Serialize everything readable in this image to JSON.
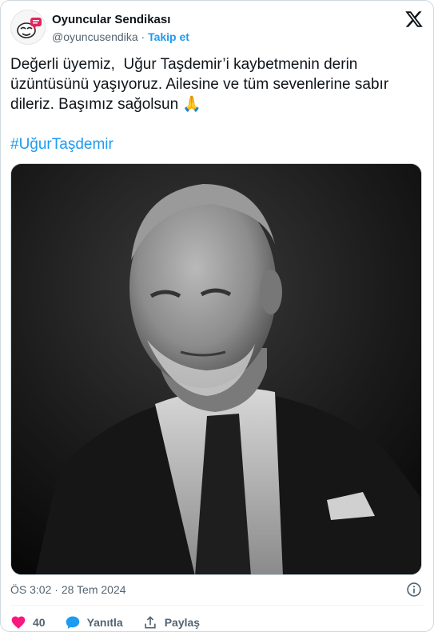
{
  "header": {
    "display_name": "Oyuncular Sendikası",
    "handle": "@oyuncusendika",
    "separator": "·",
    "follow_label": "Takip et"
  },
  "tweet": {
    "text": "Değerli üyemiz,  Uğur Taşdemir’i kaybetmenin derin üzüntüsünü yaşıyoruz. Ailesine ve tüm sevenlerine sabır dileriz. Başımız sağolsun 🙏",
    "hashtag": "#UğurTaşdemir"
  },
  "meta": {
    "time": "ÖS 3:02",
    "separator": "·",
    "date": "28 Tem 2024"
  },
  "actions": {
    "like_count": "40",
    "reply_label": "Yanıtla",
    "share_label": "Paylaş"
  },
  "colors": {
    "accent": "#1d9bf0",
    "like": "#f91880",
    "muted": "#536471"
  },
  "icons": {
    "brand": "x-logo-icon",
    "like": "heart-icon",
    "reply": "speech-bubble-icon",
    "share": "share-upload-icon",
    "info": "info-icon"
  }
}
